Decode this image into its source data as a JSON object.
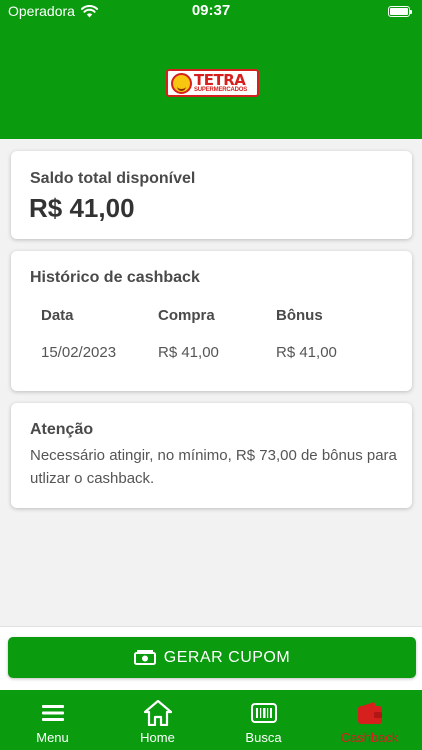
{
  "status_bar": {
    "carrier": "Operadora",
    "time": "09:37"
  },
  "header": {
    "logo_name": "TETRA",
    "logo_tagline": "SUPERMERCADOS"
  },
  "balance": {
    "title": "Saldo total disponível",
    "value": "R$ 41,00"
  },
  "history": {
    "title": "Histórico de cashback",
    "columns": [
      "Data",
      "Compra",
      "Bônus"
    ],
    "rows": [
      [
        "15/02/2023",
        "R$ 41,00",
        "R$ 41,00"
      ]
    ]
  },
  "notice": {
    "title": "Atenção",
    "text": "Necessário atingir, no mínimo, R$ 73,00 de bônus para utlizar o cashback."
  },
  "cta": {
    "label": "GERAR CUPOM",
    "icon": "money-icon"
  },
  "tabs": [
    {
      "label": "Menu",
      "icon": "menu-icon",
      "active": false
    },
    {
      "label": "Home",
      "icon": "home-icon",
      "active": false
    },
    {
      "label": "Busca",
      "icon": "barcode-icon",
      "active": false
    },
    {
      "label": "Cashback",
      "icon": "wallet-icon",
      "active": true
    }
  ],
  "colors": {
    "brand_green": "#0a9b0f",
    "active_tab": "#d6201e",
    "logo_red": "#d6201e",
    "logo_yellow": "#f7c610"
  }
}
